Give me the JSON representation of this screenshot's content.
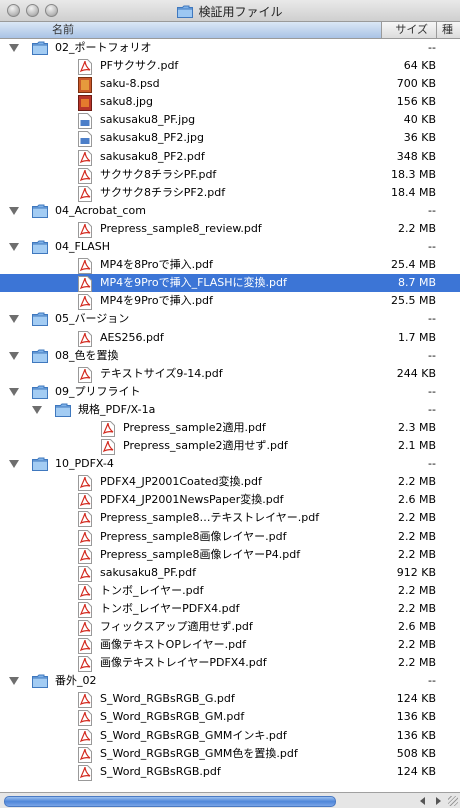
{
  "window": {
    "title": "検証用ファイル"
  },
  "columns": {
    "name": "名前",
    "size": "サイズ",
    "kind": "種"
  },
  "rows": [
    {
      "level": 0,
      "type": "folder",
      "open": true,
      "name": "02_ポートフォリオ",
      "size": "--"
    },
    {
      "level": 1,
      "type": "pdf",
      "name": "PFサクサク.pdf",
      "size": "64 KB"
    },
    {
      "level": 1,
      "type": "psd",
      "name": "saku-8.psd",
      "size": "700 KB"
    },
    {
      "level": 1,
      "type": "jpg",
      "name": "saku8.jpg",
      "size": "156 KB"
    },
    {
      "level": 1,
      "type": "jpg-doc",
      "name": "sakusaku8_PF.jpg",
      "size": "40 KB"
    },
    {
      "level": 1,
      "type": "jpg-doc",
      "name": "sakusaku8_PF2.jpg",
      "size": "36 KB"
    },
    {
      "level": 1,
      "type": "pdf",
      "name": "sakusaku8_PF2.pdf",
      "size": "348 KB"
    },
    {
      "level": 1,
      "type": "pdf",
      "name": "サクサク8チラシPF.pdf",
      "size": "18.3 MB"
    },
    {
      "level": 1,
      "type": "pdf",
      "name": "サクサク8チラシPF2.pdf",
      "size": "18.4 MB"
    },
    {
      "level": 0,
      "type": "folder",
      "open": true,
      "name": "04_Acrobat_com",
      "size": "--"
    },
    {
      "level": 1,
      "type": "pdf",
      "name": "Prepress_sample8_review.pdf",
      "size": "2.2 MB"
    },
    {
      "level": 0,
      "type": "folder",
      "open": true,
      "name": "04_FLASH",
      "size": "--"
    },
    {
      "level": 1,
      "type": "pdf",
      "name": "MP4を8Proで挿入.pdf",
      "size": "25.4 MB"
    },
    {
      "level": 1,
      "type": "pdf",
      "name": "MP4を9Proで挿入_FLASHに変換.pdf",
      "size": "8.7 MB",
      "selected": true
    },
    {
      "level": 1,
      "type": "pdf",
      "name": "MP4を9Proで挿入.pdf",
      "size": "25.5 MB"
    },
    {
      "level": 0,
      "type": "folder",
      "open": true,
      "name": "05_バージョン",
      "size": "--"
    },
    {
      "level": 1,
      "type": "pdf",
      "name": "AES256.pdf",
      "size": "1.7 MB"
    },
    {
      "level": 0,
      "type": "folder",
      "open": true,
      "name": "08_色を置換",
      "size": "--"
    },
    {
      "level": 1,
      "type": "pdf",
      "name": "テキストサイズ9-14.pdf",
      "size": "244 KB"
    },
    {
      "level": 0,
      "type": "folder",
      "open": true,
      "name": "09_プリフライト",
      "size": "--"
    },
    {
      "level": 1,
      "type": "folder",
      "open": true,
      "name": "規格_PDF/X-1a",
      "size": "--"
    },
    {
      "level": 2,
      "type": "pdf",
      "name": "Prepress_sample2適用.pdf",
      "size": "2.3 MB"
    },
    {
      "level": 2,
      "type": "pdf",
      "name": "Prepress_sample2適用せず.pdf",
      "size": "2.1 MB"
    },
    {
      "level": 0,
      "type": "folder",
      "open": true,
      "name": "10_PDFX-4",
      "size": "--"
    },
    {
      "level": 1,
      "type": "pdf",
      "name": "PDFX4_JP2001Coated変換.pdf",
      "size": "2.2 MB"
    },
    {
      "level": 1,
      "type": "pdf",
      "name": "PDFX4_JP2001NewsPaper変換.pdf",
      "size": "2.6 MB"
    },
    {
      "level": 1,
      "type": "pdf",
      "name": "Prepress_sample8…テキストレイヤー.pdf",
      "size": "2.2 MB"
    },
    {
      "level": 1,
      "type": "pdf",
      "name": "Prepress_sample8画像レイヤー.pdf",
      "size": "2.2 MB"
    },
    {
      "level": 1,
      "type": "pdf",
      "name": "Prepress_sample8画像レイヤーP4.pdf",
      "size": "2.2 MB"
    },
    {
      "level": 1,
      "type": "pdf",
      "name": "sakusaku8_PF.pdf",
      "size": "912 KB"
    },
    {
      "level": 1,
      "type": "pdf",
      "name": "トンボ_レイヤー.pdf",
      "size": "2.2 MB"
    },
    {
      "level": 1,
      "type": "pdf",
      "name": "トンボ_レイヤーPDFX4.pdf",
      "size": "2.2 MB"
    },
    {
      "level": 1,
      "type": "pdf",
      "name": "フィックスアップ適用せず.pdf",
      "size": "2.6 MB"
    },
    {
      "level": 1,
      "type": "pdf",
      "name": "画像テキストOPレイヤー.pdf",
      "size": "2.2 MB"
    },
    {
      "level": 1,
      "type": "pdf",
      "name": "画像テキストレイヤーPDFX4.pdf",
      "size": "2.2 MB"
    },
    {
      "level": 0,
      "type": "folder",
      "open": true,
      "name": "番外_02",
      "size": "--"
    },
    {
      "level": 1,
      "type": "pdf",
      "name": "S_Word_RGBsRGB_G.pdf",
      "size": "124 KB"
    },
    {
      "level": 1,
      "type": "pdf",
      "name": "S_Word_RGBsRGB_GM.pdf",
      "size": "136 KB"
    },
    {
      "level": 1,
      "type": "pdf",
      "name": "S_Word_RGBsRGB_GMMインキ.pdf",
      "size": "136 KB"
    },
    {
      "level": 1,
      "type": "pdf",
      "name": "S_Word_RGBsRGB_GMM色を置換.pdf",
      "size": "508 KB"
    },
    {
      "level": 1,
      "type": "pdf",
      "name": "S_Word_RGBsRGB.pdf",
      "size": "124 KB"
    }
  ]
}
